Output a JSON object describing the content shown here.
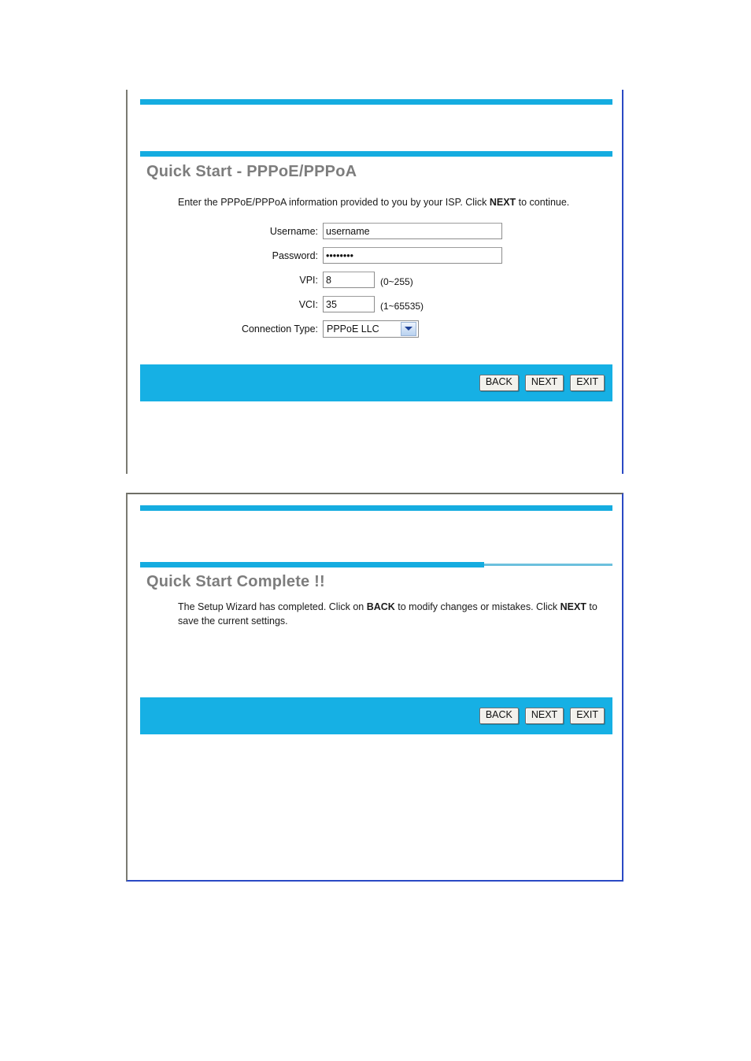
{
  "page": {
    "background": "#ffffff",
    "accent_blue": "#15ace0",
    "bar_blue": "#16b0e4",
    "title_gray": "#7d7d7d"
  },
  "panel_quick_start": {
    "title": "Quick Start - PPPoE/PPPoA",
    "description_prefix": "Enter the PPPoE/PPPoA information provided to you by your ISP. Click ",
    "description_bold": "NEXT",
    "description_suffix": " to continue.",
    "form": {
      "username": {
        "label": "Username:",
        "value": "username",
        "placeholder": ""
      },
      "password": {
        "label": "Password:",
        "value": "••••••••",
        "placeholder": ""
      },
      "vpi": {
        "label": "VPI:",
        "value": "8",
        "hint": "(0~255)"
      },
      "vci": {
        "label": "VCI:",
        "value": "35",
        "hint": "(1~65535)"
      },
      "connection_type": {
        "label": "Connection Type:",
        "selected": "PPPoE LLC",
        "arrow_icon": "chevron-down-icon"
      }
    },
    "buttons": {
      "back": "BACK",
      "next": "NEXT",
      "exit": "EXIT"
    }
  },
  "panel_complete": {
    "title": "Quick Start Complete !!",
    "description_part1": "The Setup Wizard has completed. Click on ",
    "description_bold1": "BACK",
    "description_part2": " to modify changes or mistakes. Click ",
    "description_bold2": "NEXT",
    "description_part3": " to save the current settings.",
    "buttons": {
      "back": "BACK",
      "next": "NEXT",
      "exit": "EXIT"
    }
  }
}
